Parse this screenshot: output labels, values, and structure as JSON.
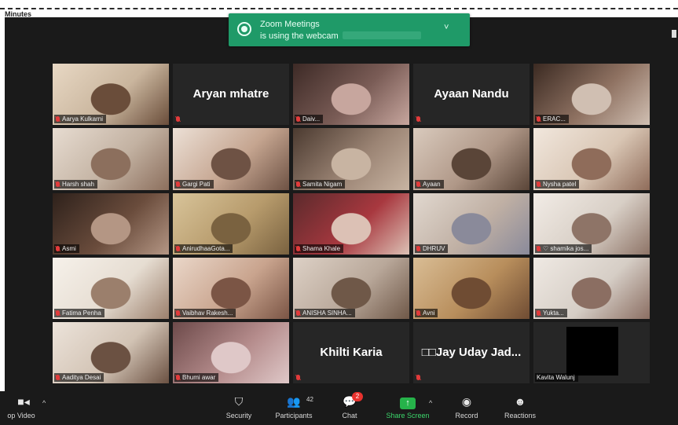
{
  "header": {
    "minutes_label": "Minutes"
  },
  "toast": {
    "line1": "Zoom Meetings",
    "line2": "is using the webcam",
    "icon": "webcam-icon",
    "chevron": "˅"
  },
  "tiles": [
    {
      "label": "Aarya Kulkarni",
      "muted": true,
      "video": true,
      "colors": [
        "#c9b59d",
        "#6a4d3a",
        "#e8d8c4"
      ]
    },
    {
      "big_name": "Aryan mhatre",
      "label": "",
      "muted": true,
      "video": false
    },
    {
      "label": "Daiv...",
      "muted": true,
      "video": true,
      "colors": [
        "#7a5c56",
        "#c7a69e",
        "#3d2a26"
      ]
    },
    {
      "big_name": "Ayaan Nandu",
      "label": "",
      "muted": true,
      "video": false
    },
    {
      "label": "ERAC...",
      "muted": true,
      "video": true,
      "colors": [
        "#8f7262",
        "#d0bfb2",
        "#3b2a22"
      ]
    },
    {
      "label": "Harsh shah",
      "muted": true,
      "video": true,
      "colors": [
        "#c3b2a2",
        "#8c6f5d",
        "#e7dcd1"
      ]
    },
    {
      "label": "Gargi Pati",
      "muted": true,
      "video": true,
      "colors": [
        "#c5a590",
        "#6e5244",
        "#ece0d6"
      ]
    },
    {
      "label": "Samita Nigam",
      "muted": true,
      "video": true,
      "colors": [
        "#9b8474",
        "#c8b4a2",
        "#4b3a30"
      ]
    },
    {
      "label": "Ayaan",
      "muted": true,
      "video": true,
      "colors": [
        "#b09888",
        "#5a4538",
        "#d9cabd"
      ]
    },
    {
      "label": "Nysha patel",
      "muted": true,
      "video": true,
      "colors": [
        "#d9c6b4",
        "#8f6c5a",
        "#f1e7dd"
      ]
    },
    {
      "label": "Asmi",
      "muted": true,
      "video": true,
      "colors": [
        "#6a4c3c",
        "#b49684",
        "#2e211b"
      ]
    },
    {
      "label": "AnirudhaaGota...",
      "muted": true,
      "video": true,
      "colors": [
        "#b79b6c",
        "#7a6240",
        "#d8c49a"
      ]
    },
    {
      "label": "Shama Khale",
      "muted": true,
      "video": true,
      "colors": [
        "#a8383f",
        "#dcc1b5",
        "#5b2a2c"
      ]
    },
    {
      "label": "DHRUV",
      "muted": true,
      "video": true,
      "colors": [
        "#c0b0a4",
        "#8a8a9a",
        "#e1d8cf"
      ]
    },
    {
      "label": "♡ shamika jos...",
      "muted": true,
      "video": true,
      "colors": [
        "#d8cfc6",
        "#8e7467",
        "#f2ece6"
      ]
    },
    {
      "label": "Fatima Penha",
      "muted": true,
      "video": true,
      "colors": [
        "#e6ddd2",
        "#9b7f6c",
        "#f6f1ea"
      ]
    },
    {
      "label": "Vaibhav Rakesh...",
      "muted": true,
      "video": true,
      "colors": [
        "#c9a48e",
        "#7b5545",
        "#ead7c9"
      ]
    },
    {
      "label": "ANISHA SINHA...",
      "muted": true,
      "video": true,
      "colors": [
        "#b9a89a",
        "#6f5848",
        "#ddd1c6"
      ]
    },
    {
      "label": "Avni",
      "muted": true,
      "video": true,
      "colors": [
        "#b88e5c",
        "#6f4c33",
        "#d9bd95"
      ]
    },
    {
      "label": "Yukta...",
      "muted": true,
      "video": true,
      "colors": [
        "#d6cec6",
        "#8b6e62",
        "#efe9e3"
      ]
    },
    {
      "label": "Aaditya Desai",
      "muted": true,
      "video": true,
      "colors": [
        "#d2c3b4",
        "#6b5142",
        "#ece3da"
      ]
    },
    {
      "label": "Bhumi awar",
      "muted": true,
      "video": true,
      "colors": [
        "#b58c8c",
        "#dfc8c8",
        "#6d4a4a"
      ]
    },
    {
      "big_name": "Khilti Karia",
      "label": "",
      "muted": true,
      "video": false
    },
    {
      "big_name": "□□Jay Uday Jad...",
      "label": "",
      "muted": true,
      "video": false
    },
    {
      "label": "Kavita Walunj",
      "muted": false,
      "video": false,
      "black_video": true
    }
  ],
  "toolbar": {
    "stop_video": "op Video",
    "video_icon": "video-camera-icon",
    "caret": "^",
    "security": "Security",
    "participants": "Participants",
    "participants_count": "42",
    "chat": "Chat",
    "chat_badge": "2",
    "share_screen": "Share Screen",
    "share_arrow": "↑",
    "record": "Record",
    "reactions": "Reactions"
  }
}
